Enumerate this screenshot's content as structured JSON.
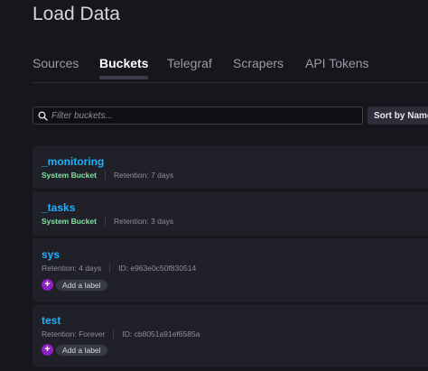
{
  "page": {
    "title": "Load Data"
  },
  "tabs": [
    {
      "label": "Sources"
    },
    {
      "label": "Buckets"
    },
    {
      "label": "Telegraf"
    },
    {
      "label": "Scrapers"
    },
    {
      "label": "API Tokens"
    }
  ],
  "filter": {
    "placeholder": "Filter buckets..."
  },
  "sort": {
    "label": "Sort by Name"
  },
  "buckets": [
    {
      "name": "_monitoring",
      "type": "System Bucket",
      "retention": "Retention: 7 days"
    },
    {
      "name": "_tasks",
      "type": "System Bucket",
      "retention": "Retention: 3 days"
    },
    {
      "name": "sys",
      "retention": "Retention: 4 days",
      "id": "ID: e963e0c50f830514",
      "add_label": "Add a label"
    },
    {
      "name": "test",
      "retention": "Retention: Forever",
      "id": "ID: cb8051a91ef6585a",
      "add_label": "Add a label"
    }
  ],
  "colors": {
    "accent": "#1fb0ff",
    "system": "#7fe69c",
    "label_plus": "#8e1fc3"
  }
}
